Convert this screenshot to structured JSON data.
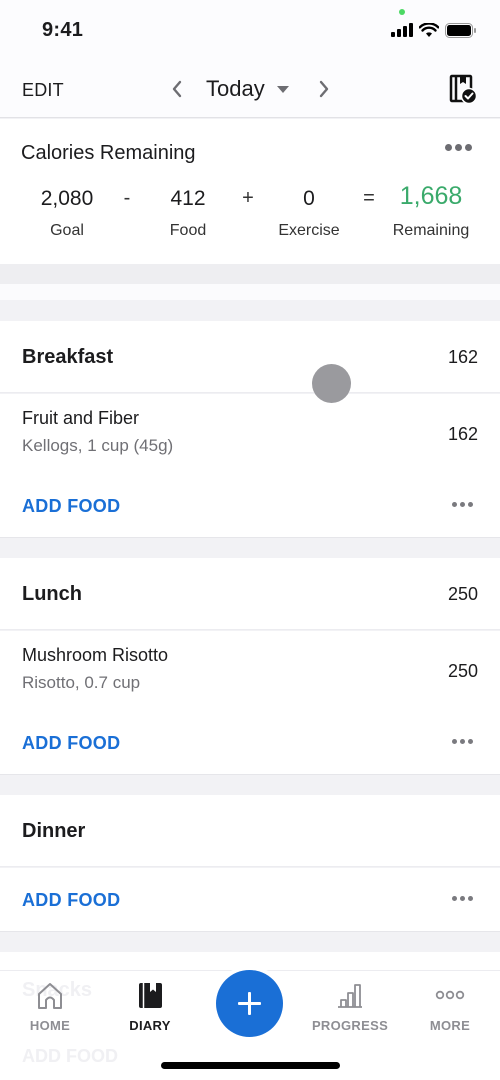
{
  "status_bar": {
    "time": "9:41",
    "icons": [
      "cellular-signal-icon",
      "wifi-icon",
      "battery-icon"
    ]
  },
  "header": {
    "edit_label": "EDIT",
    "date_label": "Today",
    "prev_icon": "chevron-left-icon",
    "next_icon": "chevron-right-icon",
    "dropdown_icon": "caret-down-icon",
    "right_icon": "diary-complete-icon"
  },
  "calories": {
    "title": "Calories Remaining",
    "goal_value": "2,080",
    "goal_label": "Goal",
    "minus": "-",
    "food_value": "412",
    "food_label": "Food",
    "plus": "+",
    "exercise_value": "0",
    "exercise_label": "Exercise",
    "equals": "=",
    "remaining_value": "1,668",
    "remaining_label": "Remaining",
    "remaining_color": "#3aaa6b"
  },
  "meals": [
    {
      "name": "Breakfast",
      "calories": "162",
      "items": [
        {
          "name": "Fruit and Fiber",
          "description": "Kellogs, 1 cup (45g)",
          "calories": "162"
        }
      ],
      "add_label": "ADD FOOD"
    },
    {
      "name": "Lunch",
      "calories": "250",
      "items": [
        {
          "name": "Mushroom Risotto",
          "description": "Risotto, 0.7 cup",
          "calories": "250"
        }
      ],
      "add_label": "ADD FOOD"
    },
    {
      "name": "Dinner",
      "calories": "",
      "items": [],
      "add_label": "ADD FOOD"
    },
    {
      "name": "Snacks",
      "calories": "",
      "items": [],
      "add_label": "ADD FOOD"
    }
  ],
  "tabbar": {
    "tabs": [
      {
        "label": "HOME",
        "icon": "home-icon",
        "active": false
      },
      {
        "label": "DIARY",
        "icon": "diary-book-icon",
        "active": true
      },
      {
        "label": "PROGRESS",
        "icon": "bar-chart-icon",
        "active": false
      },
      {
        "label": "MORE",
        "icon": "more-dots-icon",
        "active": false
      }
    ],
    "fab_icon": "plus-icon",
    "accent_color": "#1a6fd6"
  }
}
